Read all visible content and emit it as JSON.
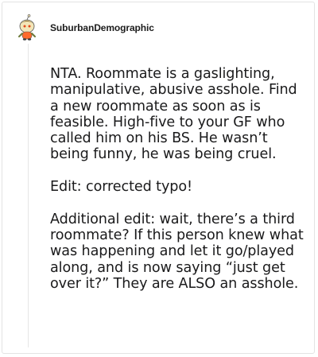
{
  "comment": {
    "username": "SuburbanDemographic",
    "paragraphs": [
      "NTA. Roommate is a gaslighting, manipulative, abusive asshole. Find a new roommate as soon as is feasible. High-five to your GF who called him on his BS. He wasn’t being funny, he was being cruel.",
      "Edit: corrected typo!",
      "Additional edit: wait, there’s a third roommate? If this person knew what was happening and let it go/played along, and is now saying “just get over it?” They are ALSO an asshole."
    ]
  },
  "icons": {
    "avatar": "snoo-avatar"
  },
  "colors": {
    "text": "#1a1a1b",
    "border": "#e3e3e3",
    "avatar_accent": "#ff6a2b"
  }
}
